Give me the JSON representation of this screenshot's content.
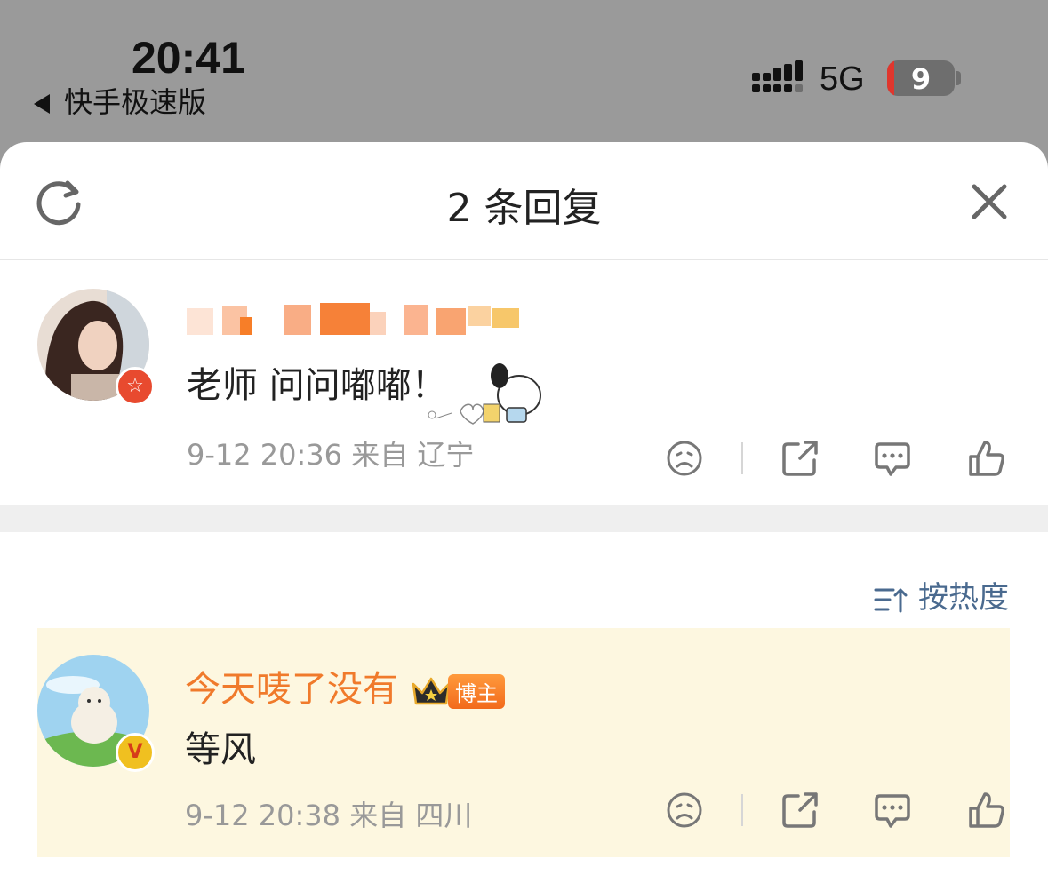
{
  "status": {
    "time": "20:41",
    "back_app": "快手极速版",
    "network": "5G",
    "battery": "9"
  },
  "header": {
    "title": "2 条回复"
  },
  "comment1": {
    "text": "老师 问问嘟嘟！",
    "date": "9-12 20:36",
    "from": "来自",
    "location": "辽宁"
  },
  "sort": {
    "label": "按热度"
  },
  "comment2": {
    "username": "今天唛了没有",
    "host_badge": "博主",
    "text": "等风",
    "date": "9-12 20:38",
    "from": "来自",
    "location": "四川"
  },
  "colors": {
    "accent_orange": "#f07a2b",
    "sort_blue": "#4a6a8f",
    "highlight_bg": "#fdf7e0"
  },
  "icons": [
    "refresh-icon",
    "close-icon",
    "dislike-icon",
    "share-icon",
    "reply-icon",
    "like-icon",
    "sort-icon",
    "crown-icon"
  ]
}
